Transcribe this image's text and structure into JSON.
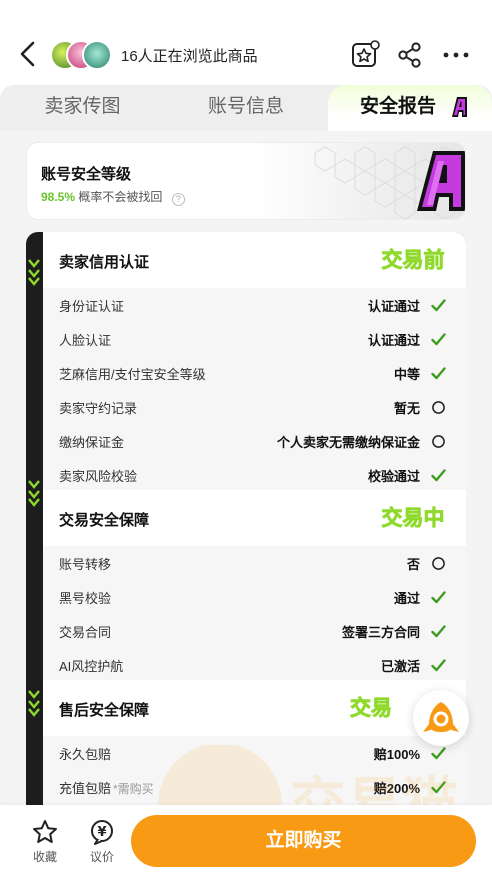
{
  "header": {
    "browse_text": "16人正在浏览此商品"
  },
  "tabs": [
    {
      "label": "卖家传图"
    },
    {
      "label": "账号信息"
    },
    {
      "label": "安全报告",
      "active": true,
      "badge": "A"
    }
  ],
  "security_level": {
    "title": "账号安全等级",
    "percent": "98.5%",
    "desc": "概率不会被找回",
    "help": "?",
    "grade": "A"
  },
  "sections": [
    {
      "title": "卖家信用认证",
      "stage": "交易前",
      "rows": [
        {
          "label": "身份证认证",
          "value": "认证通过",
          "status": "check"
        },
        {
          "label": "人脸认证",
          "value": "认证通过",
          "status": "check"
        },
        {
          "label": "芝麻信用/支付宝安全等级",
          "value": "中等",
          "status": "check"
        },
        {
          "label": "卖家守约记录",
          "value": "暂无",
          "status": "circle"
        },
        {
          "label": "缴纳保证金",
          "value": "个人卖家无需缴纳保证金",
          "status": "circle"
        },
        {
          "label": "卖家风险校验",
          "value": "校验通过",
          "status": "check"
        }
      ]
    },
    {
      "title": "交易安全保障",
      "stage": "交易中",
      "rows": [
        {
          "label": "账号转移",
          "value": "否",
          "status": "circle"
        },
        {
          "label": "黑号校验",
          "value": "通过",
          "status": "check"
        },
        {
          "label": "交易合同",
          "value": "签署三方合同",
          "status": "check"
        },
        {
          "label": "AI风控护航",
          "value": "已激活",
          "status": "check"
        }
      ]
    },
    {
      "title": "售后安全保障",
      "stage": "交易",
      "rows": [
        {
          "label": "永久包赔",
          "value": "赔100%",
          "status": "check"
        },
        {
          "label": "充值包赔",
          "note": "*需购买",
          "value": "赔200%",
          "status": "check"
        }
      ]
    }
  ],
  "bottom": {
    "fav_label": "收藏",
    "price_label": "议价",
    "price_icon": "¥",
    "buy_label": "立即购买"
  },
  "watermark": "交易猫",
  "colors": {
    "accent_green": "#6ac32a",
    "check_green": "#3e9d20",
    "buy_orange": "#f99a14",
    "grade_purple": "#c53be0"
  }
}
